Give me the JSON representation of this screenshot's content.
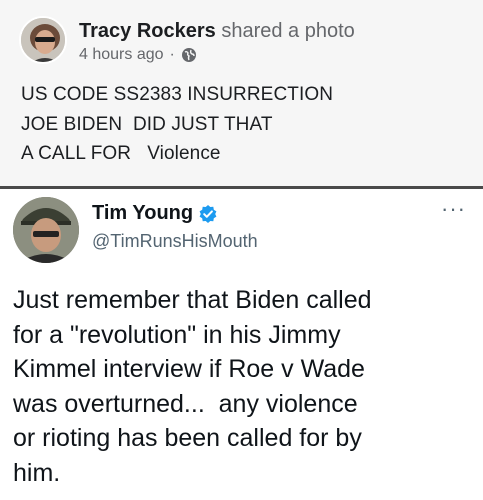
{
  "facebook_post": {
    "author": "Tracy Rockers",
    "action": "shared a photo",
    "time": "4 hours ago",
    "separator": "·",
    "privacy_icon": "globe-icon",
    "lines": [
      "US CODE SS2383 INSURRECTION",
      "JOE BIDEN  DID JUST THAT",
      "A CALL FOR   Violence"
    ]
  },
  "tweet": {
    "name": "Tim Young",
    "handle": "@TimRunsHisMouth",
    "verified_icon": "verified-badge-icon",
    "more_icon": "more-options-icon",
    "more_label": "···",
    "lines": [
      "Just remember that Biden called",
      "for a \"revolution\" in his Jimmy",
      "Kimmel interview if Roe v Wade",
      "was overturned...  any violence",
      "or rioting has been called for by",
      "him."
    ]
  },
  "colors": {
    "verified_blue": "#1d9bf0",
    "fb_meta_gray": "#65676b",
    "tweet_handle_gray": "#536471"
  }
}
